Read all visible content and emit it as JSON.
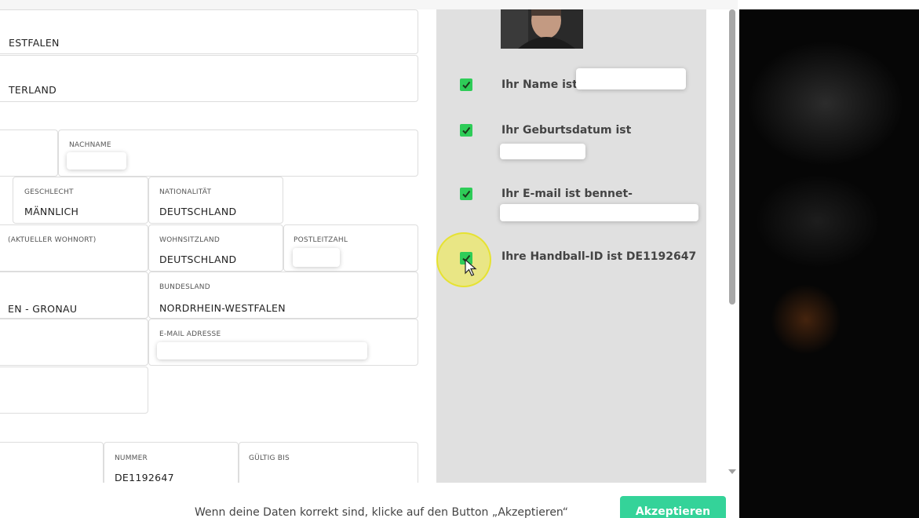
{
  "form": {
    "state_value_partial": "ESTFALEN",
    "country_value_partial": "TERLAND",
    "surname_label": "NACHNAME",
    "gender_label": "GESCHLECHT",
    "gender_value": "MÄNNLICH",
    "nationality_label": "NATIONALITÄT",
    "nationality_value": "DEUTSCHLAND",
    "city_label_partial": "(AKTUELLER WOHNORT)",
    "residence_country_label": "WOHNSITZLAND",
    "residence_country_value": "DEUTSCHLAND",
    "postcode_label": "POSTLEITZAHL",
    "city_value_partial": "EN - GRONAU",
    "bundesland_label": "BUNDESLAND",
    "bundesland_value": "NORDRHEIN-WESTFALEN",
    "email_label": "E-MAIL ADRESSE",
    "number_label": "NUMMER",
    "number_value": "DE1192647",
    "valid_until_label": "GÜLTIG BIS"
  },
  "verification": {
    "name_text": "Ihr Name ist",
    "birthdate_text": "Ihr Geburtsdatum ist",
    "email_text": "Ihr E-mail ist bennet-",
    "handball_id_text": "Ihre Handball-ID ist DE1192647"
  },
  "footer": {
    "instruction": "Wenn deine Daten korrekt sind, klicke auf den Button „Akzeptieren“",
    "accept_label": "Akzeptieren"
  },
  "colors": {
    "check_green": "#2ecc58",
    "accept_green": "#34d399",
    "panel_gray": "#e0e0e0",
    "cursor_highlight": "#f0eb3a"
  },
  "icons": [
    "checkmark-icon",
    "cursor-icon"
  ]
}
